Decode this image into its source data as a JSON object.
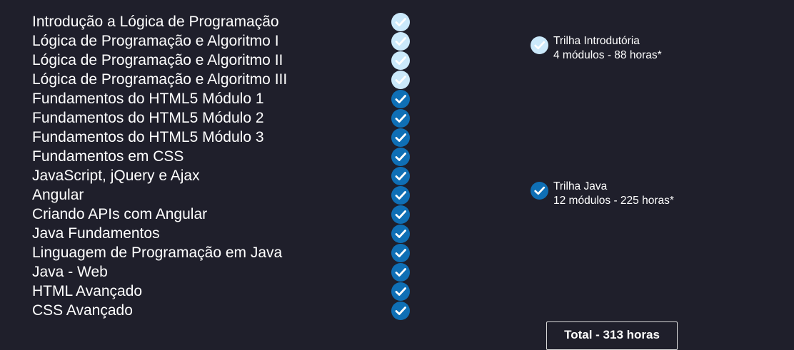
{
  "courses": [
    {
      "title": "Introdução a Lógica de Programação",
      "status": "intro"
    },
    {
      "title": "Lógica de Programação e Algoritmo I",
      "status": "intro"
    },
    {
      "title": "Lógica de Programação e Algoritmo II",
      "status": "intro"
    },
    {
      "title": "Lógica de Programação e Algoritmo III",
      "status": "intro"
    },
    {
      "title": "Fundamentos do HTML5 Módulo 1",
      "status": "java"
    },
    {
      "title": "Fundamentos do HTML5 Módulo 2",
      "status": "java"
    },
    {
      "title": "Fundamentos do HTML5 Módulo 3",
      "status": "java"
    },
    {
      "title": "Fundamentos em CSS",
      "status": "java"
    },
    {
      "title": "JavaScript, jQuery e Ajax",
      "status": "java"
    },
    {
      "title": "Angular",
      "status": "java"
    },
    {
      "title": "Criando APIs com Angular",
      "status": "java"
    },
    {
      "title": "Java Fundamentos",
      "status": "java"
    },
    {
      "title": "Linguagem de Programação em Java",
      "status": "java"
    },
    {
      "title": "Java - Web",
      "status": "java"
    },
    {
      "title": "HTML Avançado",
      "status": "java"
    },
    {
      "title": "CSS Avançado",
      "status": "java"
    }
  ],
  "tracks": {
    "intro": {
      "name": "Trilha Introdutória",
      "details": "4 módulos - 88 horas*",
      "icon": "check-circle-icon",
      "color": "#cbe9fb"
    },
    "java": {
      "name": "Trilha Java",
      "details": "12 módulos - 225 horas*",
      "icon": "check-circle-icon",
      "color": "#0f6fb5"
    }
  },
  "total": {
    "label": "Total - 313 horas"
  },
  "colors": {
    "background": "#1f1f2b",
    "text": "#ffffff",
    "check_mark": "#ffffff"
  }
}
